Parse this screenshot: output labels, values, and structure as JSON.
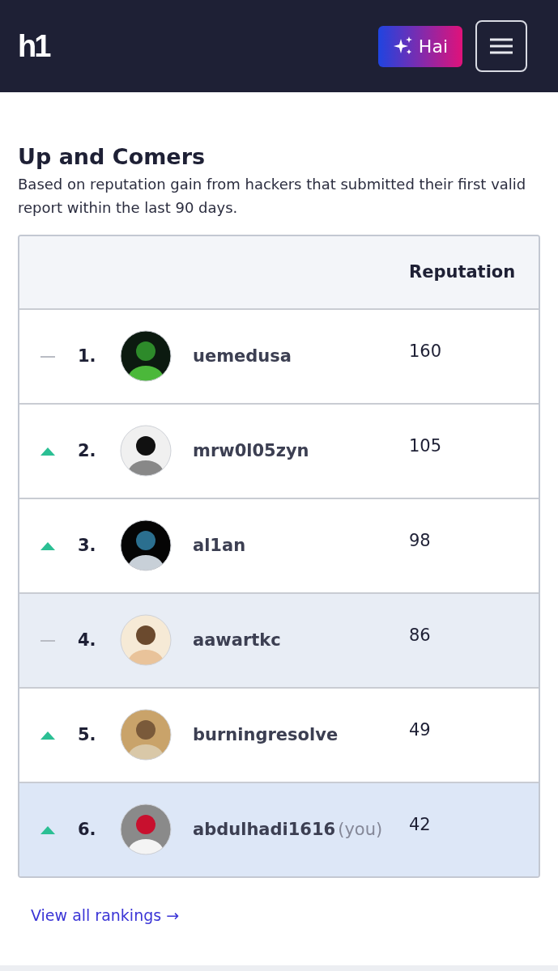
{
  "header": {
    "logo": "h1",
    "ai_button": "Hai"
  },
  "section": {
    "title": "Up and Comers",
    "description": "Based on reputation gain from hackers that submitted their first valid report within the last 90 days."
  },
  "table": {
    "columns": [
      "Reputation"
    ],
    "rows": [
      {
        "kind": "same",
        "rank": "1.",
        "username": "uemedusa",
        "reputation": "160",
        "hovered": false,
        "current_user": false
      },
      {
        "kind": "up",
        "rank": "2.",
        "username": "mrw0l05zyn",
        "reputation": "105",
        "hovered": false,
        "current_user": false
      },
      {
        "kind": "up",
        "rank": "3.",
        "username": "al1an",
        "reputation": "98",
        "hovered": false,
        "current_user": false
      },
      {
        "kind": "same",
        "rank": "4.",
        "username": "aawartkc",
        "reputation": "86",
        "hovered": true,
        "current_user": false
      },
      {
        "kind": "up",
        "rank": "5.",
        "username": "burningresolve",
        "reputation": "49",
        "hovered": false,
        "current_user": false
      },
      {
        "kind": "up",
        "rank": "6.",
        "username": "abdulhadi1616",
        "you_label": "(you)",
        "reputation": "42",
        "hovered": false,
        "current_user": true
      }
    ]
  },
  "footer_link": "View all rankings →"
}
